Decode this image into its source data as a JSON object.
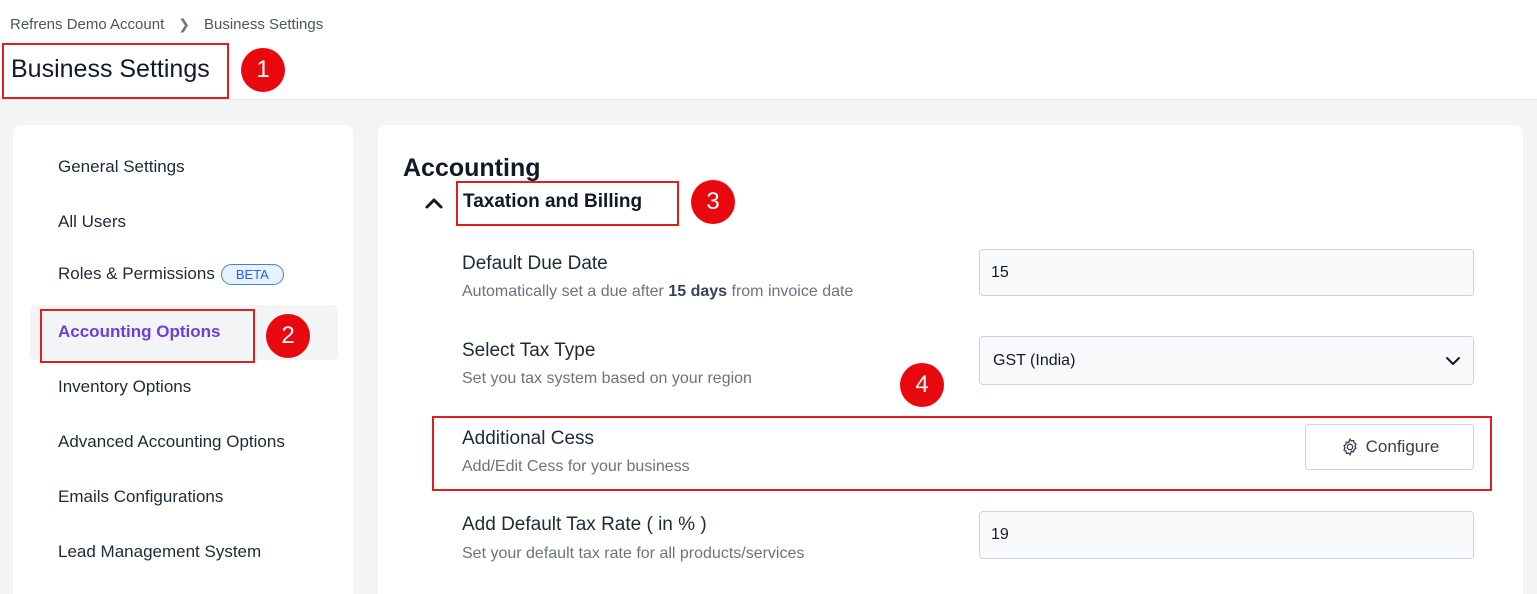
{
  "breadcrumb": {
    "root": "Refrens Demo Account",
    "current": "Business Settings"
  },
  "page": {
    "title": "Business Settings"
  },
  "sidebar": {
    "items": [
      {
        "label": "General Settings"
      },
      {
        "label": "All Users"
      },
      {
        "label": "Roles & Permissions",
        "badge": "BETA"
      },
      {
        "label": "Accounting Options",
        "active": true
      },
      {
        "label": "Inventory Options"
      },
      {
        "label": "Advanced Accounting Options"
      },
      {
        "label": "Emails Configurations"
      },
      {
        "label": "Lead Management System"
      }
    ]
  },
  "main": {
    "section_title": "Accounting",
    "subsection_title": "Taxation and Billing",
    "due_date": {
      "label": "Default Due Date",
      "desc_prefix": "Automatically set a due after ",
      "desc_bold": "15 days",
      "desc_suffix": " from invoice date",
      "value": "15"
    },
    "tax_type": {
      "label": "Select Tax Type",
      "desc": "Set you tax system based on your region",
      "value": "GST (India)"
    },
    "cess": {
      "label": "Additional Cess",
      "desc": "Add/Edit Cess for your business",
      "button_label": "Configure"
    },
    "tax_rate": {
      "label": "Add Default Tax Rate ( in % )",
      "desc": "Set your default tax rate for all products/services",
      "value": "19"
    }
  },
  "annotations": {
    "m1": "1",
    "m2": "2",
    "m3": "3",
    "m4": "4"
  },
  "colors": {
    "accent": "#6d3fd6",
    "marker": "#e8080d",
    "highlight_box": "#e11d1d"
  }
}
